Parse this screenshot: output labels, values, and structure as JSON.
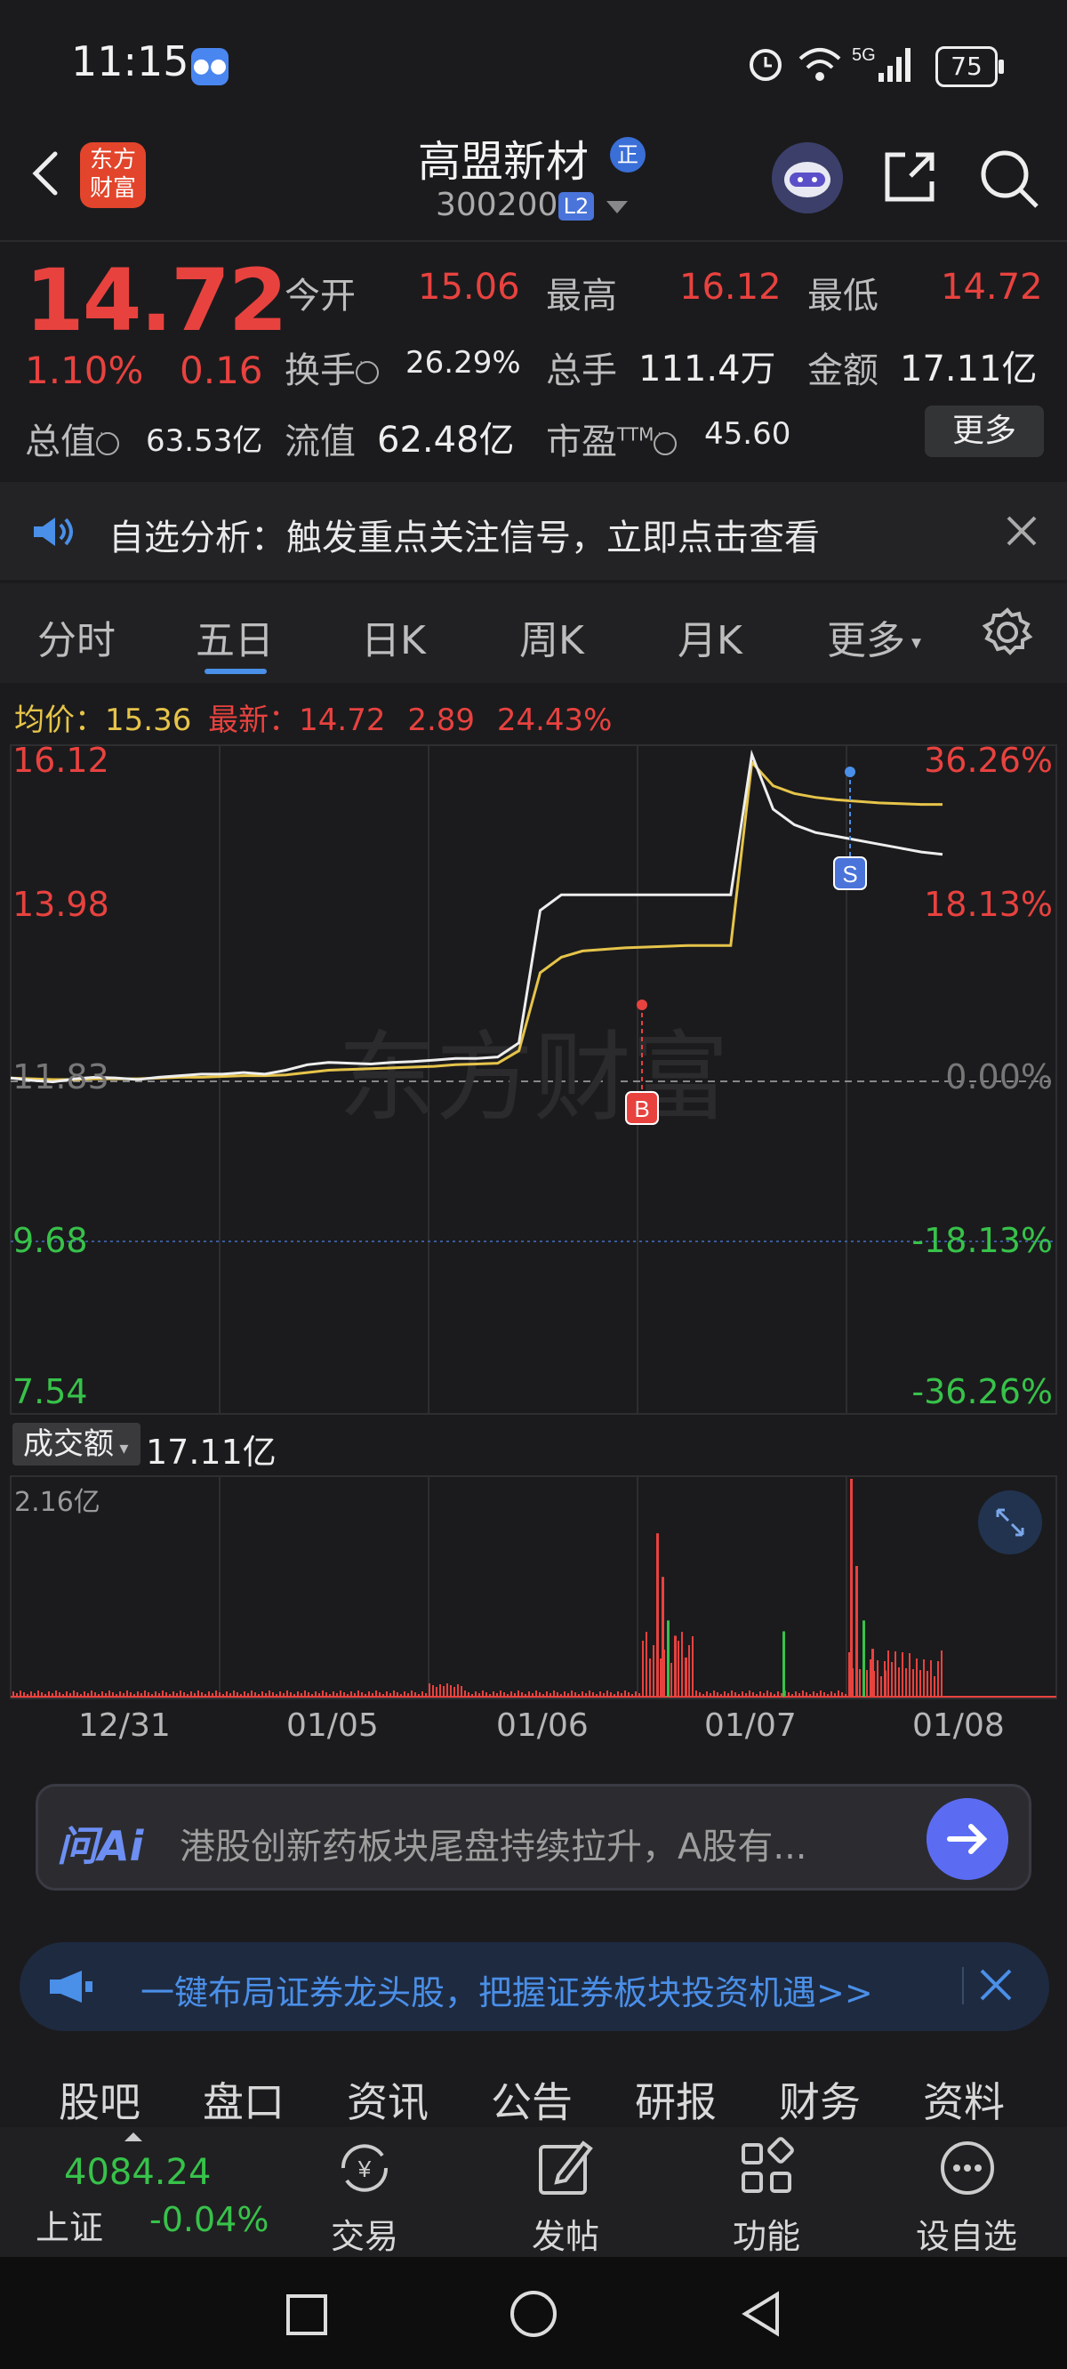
{
  "status_bar": {
    "time": "11:15",
    "battery": "75",
    "network": "5G"
  },
  "header": {
    "stock_name": "高盟新材",
    "badge": "正",
    "code": "300200",
    "level": "L2",
    "logo_text": "东方财富"
  },
  "quote": {
    "price": "14.72",
    "pct_change": "1.10%",
    "change": "0.16",
    "open_label": "今开",
    "open": "15.06",
    "high_label": "最高",
    "high": "16.12",
    "low_label": "最低",
    "low": "14.72",
    "turnover_label": "换手",
    "turnover": "26.29%",
    "volume_label": "总手",
    "volume": "111.4万",
    "amount_label": "金额",
    "amount": "17.11亿",
    "market_cap_label": "总值",
    "market_cap": "63.53亿",
    "float_cap_label": "流值",
    "float_cap": "62.48亿",
    "pe_label": "市盈",
    "pe_sup": "TTM",
    "pe": "45.60",
    "more_label": "更多"
  },
  "notice": {
    "text": "自选分析：触发重点关注信号，立即点击查看"
  },
  "tabs": [
    "分时",
    "五日",
    "日K",
    "周K",
    "月K",
    "更多"
  ],
  "active_tab": "五日",
  "chart_legend": {
    "avg_label": "均价：",
    "avg": "15.36",
    "latest_label": "最新：",
    "latest": "14.72",
    "change": "2.89",
    "pct": "24.43%"
  },
  "chart_data": {
    "type": "line",
    "y_axis_left": [
      "16.12",
      "13.98",
      "11.83",
      "9.68",
      "7.54"
    ],
    "y_axis_right": [
      "36.26%",
      "18.13%",
      "0.00%",
      "-18.13%",
      "-36.26%"
    ],
    "ylim": [
      7.54,
      16.12
    ],
    "x_labels": [
      "12/31",
      "01/05",
      "01/06",
      "01/07",
      "01/08"
    ],
    "series": [
      {
        "values": [
          11.85,
          11.82,
          11.8,
          11.84,
          11.86,
          11.85,
          11.83,
          11.86,
          11.88,
          11.9,
          11.9,
          11.92,
          11.9,
          11.95,
          12.02,
          12.05,
          12.04,
          12.03,
          12.05,
          12.06,
          12.08,
          12.1,
          12.1,
          12.12,
          12.3,
          14.0,
          14.2,
          14.2,
          14.2,
          14.2,
          14.2,
          14.2,
          14.2,
          14.2,
          14.2,
          16.0,
          15.3,
          15.1,
          15.0,
          14.95,
          14.9,
          14.85,
          14.8,
          14.75,
          14.72
        ]
      },
      {
        "values": [
          11.85,
          11.84,
          11.83,
          11.83,
          11.84,
          11.84,
          11.84,
          11.85,
          11.86,
          11.86,
          11.87,
          11.88,
          11.88,
          11.89,
          11.92,
          11.95,
          11.96,
          11.97,
          11.98,
          11.99,
          12.0,
          12.02,
          12.03,
          12.04,
          12.2,
          13.2,
          13.4,
          13.48,
          13.5,
          13.52,
          13.53,
          13.54,
          13.55,
          13.55,
          13.55,
          15.9,
          15.6,
          15.5,
          15.45,
          15.42,
          15.4,
          15.38,
          15.37,
          15.36,
          15.36
        ]
      }
    ],
    "markers": [
      {
        "label": "B"
      },
      {
        "label": "S"
      }
    ]
  },
  "volume": {
    "label": "成交额",
    "value": "17.11亿",
    "max": "2.16亿"
  },
  "ai_bar": {
    "logo": "问Ai",
    "text": "港股创新药板块尾盘持续拉升，A股有..."
  },
  "promo": {
    "text": "一键布局证券龙头股，把握证券板块投资机遇>>"
  },
  "bottom_tabs": [
    "股吧",
    "盘口",
    "资讯",
    "公告",
    "研报",
    "财务",
    "资料"
  ],
  "footer": {
    "index_value": "4084.24",
    "index_name": "上证",
    "index_pct": "-0.04%",
    "buttons": [
      "交易",
      "发帖",
      "功能",
      "设自选"
    ]
  },
  "colors": {
    "up": "#e8423f",
    "down": "#37c24a",
    "accent": "#4a8fe8",
    "avg_line": "#e6c44a"
  }
}
